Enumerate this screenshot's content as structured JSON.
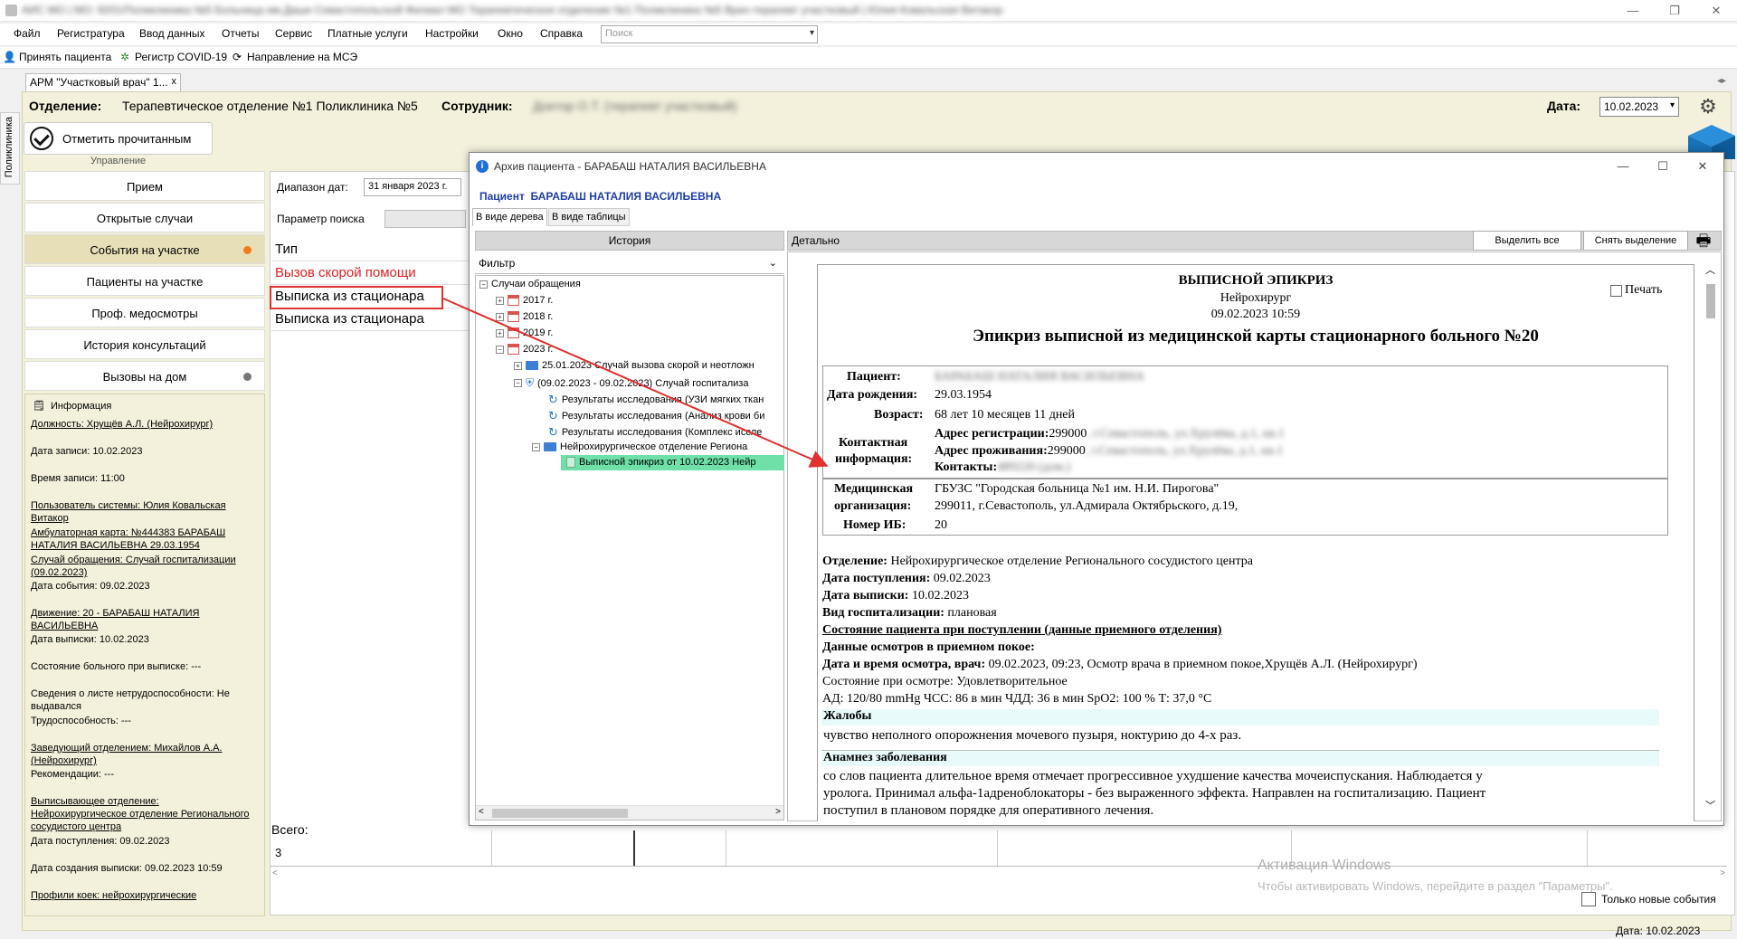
{
  "window": {
    "title": "АИС МО | МО: 9201/Поликлиника №5 Больница им.Даши Севастопольской Филиал МО Терапевтическое отделение №1 Поликлиника №5 Врач-терапевт участковый | Юлия Ковальская Витакор",
    "minimize": "—",
    "restore": "❐",
    "close": "✕"
  },
  "menu": [
    "Файл",
    "Регистратура",
    "Ввод данных",
    "Отчеты",
    "Сервис",
    "Платные услуги",
    "Настройки",
    "Окно",
    "Справка"
  ],
  "global_search": {
    "placeholder": "Поиск"
  },
  "toolbar": {
    "accept_patient": "Принять пациента",
    "covid_registry": "Регистр COVID-19",
    "mse_referral": "Направление на МСЭ"
  },
  "left_strip": "Поликлиника",
  "doc_tab": {
    "label": "АРМ \"Участковый врач\" 1...",
    "close": "x"
  },
  "header": {
    "dept_label": "Отделение:",
    "dept_value": "Терапевтическое отделение №1 Поликлиника №5",
    "employee_label": "Сотрудник:",
    "employee_value": "Доктор О.Т. (терапевт участковый)",
    "date_label": "Дата:",
    "date_value": "10.02.2023"
  },
  "actions": {
    "mark_read": "Отметить прочитанным",
    "section": "Управление"
  },
  "nav": [
    {
      "label": "Прием"
    },
    {
      "label": "Открытые случаи"
    },
    {
      "label": "События на участке",
      "dot": "#f47a20"
    },
    {
      "label": "Пациенты на участке"
    },
    {
      "label": "Проф. медосмотры"
    },
    {
      "label": "История консультаций"
    },
    {
      "label": "Вызовы на дом",
      "dot": "#777777"
    }
  ],
  "info": {
    "title": "Информация",
    "lines": [
      "Должность: Хрущёв А.Л. (Нейрохирург)",
      "Дата записи: 10.02.2023",
      "Время записи: 11:00",
      "Пользователь системы: Юлия Ковальская Витакор",
      "Амбулаторная карта: №444383 БАРАБАШ НАТАЛИЯ ВАСИЛЬЕВНА 29.03.1954",
      "Случай обращения: Случай госпитализации (09.02.2023)",
      "Дата события: 09.02.2023",
      "Движение: 20 - БАРАБАШ НАТАЛИЯ ВАСИЛЬЕВНА",
      "Дата выписки: 10.02.2023",
      "Состояние больного при выписке: ---",
      "Сведения о листе нетрудоспособности: Не выдавался",
      "Трудоспособность: ---",
      "Заведующий отделением: Михайлов А.А. (Нейрохирург)",
      "Рекомендации: ---",
      "Выписывающее отделение: Нейрохирургическое отделение Регионального сосудистого центра",
      "Дата поступления: 09.02.2023",
      "Дата создания выписки: 09.02.2023 10:59",
      "Профили коек: нейрохирургические"
    ]
  },
  "events": {
    "date_range_label": "Диапазон дат:",
    "date_range_value": "31 января 2023 г.",
    "search_param_label": "Параметр поиска",
    "type_header": "Тип",
    "rows": [
      {
        "text": "Вызов скорой помощи",
        "color": "#e02020"
      },
      {
        "text": "Выписка из стационара",
        "color": "#000000"
      },
      {
        "text": "Выписка из стационара",
        "color": "#000000"
      }
    ],
    "total_label": "Всего:",
    "total_value": "3"
  },
  "windows_activation": {
    "title": "Активация Windows",
    "text": "Чтобы активировать Windows, перейдите в раздел \"Параметры\"."
  },
  "only_new": "Только новые события",
  "status_date": "Дата: 10.02.2023",
  "archive": {
    "title": "Архив пациента - БАРАБАШ НАТАЛИЯ ВАСИЛЬЕВНА",
    "patient_label": "Пациент",
    "patient_name": "БАРАБАШ НАТАЛИЯ ВАСИЛЬЕВНА",
    "tab_tree": "В виде дерева",
    "tab_table": "В виде таблицы",
    "history_header": "История",
    "filter": "Фильтр",
    "tree": [
      "Случаи обращения",
      "2017 г.",
      "2018 г.",
      "2019 г.",
      "2023 г.",
      "25.01.2023 Случай вызова скорой и неотложн",
      "(09.02.2023 - 09.02.2023) Случай госпитализа",
      "Результаты исследования (УЗИ мягких ткан",
      "Результаты исследования (Анализ крови би",
      "Результаты исследования (Комплекс иссле",
      "Нейрохирургическое отделение Региона",
      "Выписной эпикриз от 10.02.2023 Нейр"
    ],
    "detail_header": "Детально",
    "select_all": "Выделить все",
    "deselect": "Снять выделение",
    "print_label": "Печать"
  },
  "epicrisis": {
    "title": "ВЫПИСНОЙ ЭПИКРИЗ",
    "specialty": "Нейрохирург",
    "datetime": "09.02.2023 10:59",
    "heading": "Эпикриз выписной из медицинской карты стационарного больного №20",
    "patient_label": "Пациент:",
    "patient_value": "БАРАБАШ НАТАЛИЯ ВАСИЛЬЕВНА",
    "dob_label": "Дата рождения:",
    "dob_value": "29.03.1954",
    "age_label": "Возраст:",
    "age_value": "68 лет 10 месяцев 11 дней",
    "contact_label1": "Контактная",
    "contact_label2": "информация:",
    "reg_addr_label": "Адрес регистрации:",
    "reg_addr_code": "299000",
    "reg_addr_rest": ", г.Севастополь, ул.Хрулёва, д.1, кв.1",
    "live_addr_label": "Адрес проживания:",
    "live_addr_code": "299000",
    "live_addr_rest": ", г.Севастополь, ул.Хрулёва, д.1, кв.1",
    "contacts_label": "Контакты:",
    "contacts_value": "489220 (дом.)",
    "org_label1": "Медицинская",
    "org_label2": "организация:",
    "org_value1": "ГБУЗС \"Городская больница №1 им. Н.И. Пирогова\"",
    "org_value2": "299011, г.Севастополь, ул.Адмирала Октябрьского, д.19,",
    "ib_label": "Номер ИБ:",
    "ib_value": "20",
    "dept_label": "Отделение:",
    "dept_value": "Нейрохирургическое отделение Регионального сосудистого центра",
    "admit_label": "Дата поступления:",
    "admit_value": "09.02.2023",
    "discharge_label": "Дата выписки:",
    "discharge_value": "10.02.2023",
    "hosp_type_label": "Вид госпитализации:",
    "hosp_type_value": "плановая",
    "admission_state": "Состояние пациента при поступлении (данные приемного отделения)",
    "er_exam": "Данные осмотров в приемном покое:",
    "exam_dt_label": "Дата и время осмотра, врач:",
    "exam_dt_value": "09.02.2023, 09:23, Осмотр врача в приемном покое,Хрущёв А.Л. (Нейрохирург)",
    "exam_state": "Состояние при осмотре: Удовлетворительное",
    "vitals": "АД: 120/80 mmHg ЧСС: 86 в мин ЧДД: 36 в мин SpO2: 100 % Т: 37,0 °С",
    "complaints_title": "Жалобы",
    "complaints_text": "чувство неполного опорожнения мочевого пузыря, ноктурию до 4-х раз.",
    "anamnesis_title": "Анамнез заболевания",
    "anamnesis_1": "со слов пациента длительное время отмечает прогрессивное ухудшение качества мочеиспускания. Наблюдается у",
    "anamnesis_2": "уролога. Принимал альфа-1адреноблокаторы - без выраженного эффекта. Направлен на госпитализацию. Пациент",
    "anamnesis_3": "поступил в плановом порядке для оперативного лечения."
  }
}
